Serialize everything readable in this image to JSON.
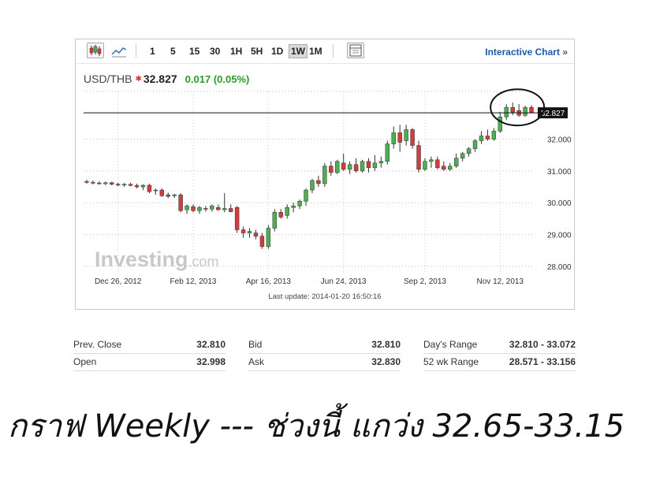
{
  "toolbar": {
    "intervals": [
      "1",
      "5",
      "15",
      "30",
      "1H",
      "5H",
      "1D",
      "1W",
      "1M"
    ],
    "active_interval": "1W",
    "interactive_label": "Interactive Chart",
    "interactive_arrow": "»",
    "icons": [
      "candlestick-chart-icon",
      "line-chart-icon",
      "settings-panel-icon"
    ]
  },
  "quote": {
    "symbol": "USD/THB",
    "price": "32.827",
    "change": "0.017 (0.05%)",
    "direction_color": "#e03030",
    "change_color": "#2a9a2a"
  },
  "chart_data": {
    "type": "candlestick",
    "ylim": [
      27.8,
      33.5
    ],
    "y_ticks": [
      "28.000",
      "29.000",
      "30.000",
      "31.000",
      "32.000"
    ],
    "x_tick_labels": [
      "Dec 26, 2012",
      "Feb 12, 2013",
      "Apr 16, 2013",
      "Jun 24, 2013",
      "Sep 2, 2013",
      "Nov 12, 2013"
    ],
    "last_price_label": "32.827",
    "last_price": 32.827,
    "up_color": "#4caf50",
    "down_color": "#d23c3c",
    "watermark": "Investing",
    "watermark_suffix": ".com",
    "candles": [
      {
        "o": 30.67,
        "h": 30.72,
        "l": 30.6,
        "c": 30.64
      },
      {
        "o": 30.64,
        "h": 30.7,
        "l": 30.58,
        "c": 30.62
      },
      {
        "o": 30.62,
        "h": 30.68,
        "l": 30.57,
        "c": 30.6
      },
      {
        "o": 30.6,
        "h": 30.66,
        "l": 30.55,
        "c": 30.63
      },
      {
        "o": 30.63,
        "h": 30.66,
        "l": 30.55,
        "c": 30.58
      },
      {
        "o": 30.58,
        "h": 30.63,
        "l": 30.52,
        "c": 30.56
      },
      {
        "o": 30.56,
        "h": 30.62,
        "l": 30.5,
        "c": 30.58
      },
      {
        "o": 30.58,
        "h": 30.63,
        "l": 30.52,
        "c": 30.54
      },
      {
        "o": 30.54,
        "h": 30.6,
        "l": 30.45,
        "c": 30.5
      },
      {
        "o": 30.5,
        "h": 30.58,
        "l": 30.4,
        "c": 30.55
      },
      {
        "o": 30.55,
        "h": 30.6,
        "l": 30.3,
        "c": 30.35
      },
      {
        "o": 30.38,
        "h": 30.45,
        "l": 30.25,
        "c": 30.4
      },
      {
        "o": 30.4,
        "h": 30.45,
        "l": 30.18,
        "c": 30.22
      },
      {
        "o": 30.25,
        "h": 30.32,
        "l": 30.15,
        "c": 30.2
      },
      {
        "o": 30.22,
        "h": 30.28,
        "l": 30.15,
        "c": 30.25
      },
      {
        "o": 30.25,
        "h": 30.3,
        "l": 29.7,
        "c": 29.75
      },
      {
        "o": 29.78,
        "h": 29.95,
        "l": 29.65,
        "c": 29.9
      },
      {
        "o": 29.88,
        "h": 29.95,
        "l": 29.7,
        "c": 29.75
      },
      {
        "o": 29.75,
        "h": 29.9,
        "l": 29.65,
        "c": 29.85
      },
      {
        "o": 29.82,
        "h": 29.9,
        "l": 29.72,
        "c": 29.8
      },
      {
        "o": 29.8,
        "h": 29.95,
        "l": 29.72,
        "c": 29.9
      },
      {
        "o": 29.85,
        "h": 29.95,
        "l": 29.75,
        "c": 29.78
      },
      {
        "o": 29.78,
        "h": 30.3,
        "l": 29.7,
        "c": 29.82
      },
      {
        "o": 29.82,
        "h": 29.95,
        "l": 29.7,
        "c": 29.72
      },
      {
        "o": 29.85,
        "h": 29.9,
        "l": 29.05,
        "c": 29.15
      },
      {
        "o": 29.15,
        "h": 29.25,
        "l": 28.9,
        "c": 29.05
      },
      {
        "o": 29.05,
        "h": 29.2,
        "l": 28.9,
        "c": 29.1
      },
      {
        "o": 29.05,
        "h": 29.15,
        "l": 28.85,
        "c": 28.95
      },
      {
        "o": 28.95,
        "h": 29.05,
        "l": 28.55,
        "c": 28.62
      },
      {
        "o": 28.62,
        "h": 29.3,
        "l": 28.55,
        "c": 29.2
      },
      {
        "o": 29.2,
        "h": 29.8,
        "l": 29.1,
        "c": 29.7
      },
      {
        "o": 29.7,
        "h": 29.8,
        "l": 29.5,
        "c": 29.55
      },
      {
        "o": 29.6,
        "h": 29.95,
        "l": 29.5,
        "c": 29.85
      },
      {
        "o": 29.85,
        "h": 30.0,
        "l": 29.7,
        "c": 29.9
      },
      {
        "o": 29.9,
        "h": 30.1,
        "l": 29.8,
        "c": 30.05
      },
      {
        "o": 30.05,
        "h": 30.45,
        "l": 29.9,
        "c": 30.4
      },
      {
        "o": 30.4,
        "h": 30.75,
        "l": 30.3,
        "c": 30.7
      },
      {
        "o": 30.7,
        "h": 30.85,
        "l": 30.5,
        "c": 30.6
      },
      {
        "o": 30.6,
        "h": 31.25,
        "l": 30.5,
        "c": 31.15
      },
      {
        "o": 31.15,
        "h": 31.3,
        "l": 30.85,
        "c": 30.95
      },
      {
        "o": 30.95,
        "h": 31.35,
        "l": 30.9,
        "c": 31.3
      },
      {
        "o": 31.25,
        "h": 31.55,
        "l": 31.0,
        "c": 31.05
      },
      {
        "o": 31.05,
        "h": 31.3,
        "l": 30.9,
        "c": 31.2
      },
      {
        "o": 31.2,
        "h": 31.4,
        "l": 30.95,
        "c": 31.0
      },
      {
        "o": 31.0,
        "h": 31.35,
        "l": 30.95,
        "c": 31.3
      },
      {
        "o": 31.3,
        "h": 31.4,
        "l": 30.95,
        "c": 31.1
      },
      {
        "o": 31.1,
        "h": 31.5,
        "l": 31.0,
        "c": 31.25
      },
      {
        "o": 31.25,
        "h": 31.45,
        "l": 31.1,
        "c": 31.3
      },
      {
        "o": 31.3,
        "h": 31.95,
        "l": 31.2,
        "c": 31.85
      },
      {
        "o": 31.85,
        "h": 32.4,
        "l": 31.7,
        "c": 32.2
      },
      {
        "o": 32.2,
        "h": 32.45,
        "l": 31.6,
        "c": 31.9
      },
      {
        "o": 31.95,
        "h": 32.45,
        "l": 31.8,
        "c": 32.3
      },
      {
        "o": 32.3,
        "h": 32.35,
        "l": 31.7,
        "c": 31.8
      },
      {
        "o": 31.8,
        "h": 31.95,
        "l": 30.95,
        "c": 31.05
      },
      {
        "o": 31.05,
        "h": 31.4,
        "l": 31.0,
        "c": 31.3
      },
      {
        "o": 31.3,
        "h": 31.45,
        "l": 31.1,
        "c": 31.35
      },
      {
        "o": 31.35,
        "h": 31.45,
        "l": 31.05,
        "c": 31.1
      },
      {
        "o": 31.15,
        "h": 31.3,
        "l": 31.0,
        "c": 31.05
      },
      {
        "o": 31.05,
        "h": 31.25,
        "l": 31.0,
        "c": 31.15
      },
      {
        "o": 31.15,
        "h": 31.55,
        "l": 31.1,
        "c": 31.4
      },
      {
        "o": 31.4,
        "h": 31.6,
        "l": 31.3,
        "c": 31.55
      },
      {
        "o": 31.55,
        "h": 31.75,
        "l": 31.45,
        "c": 31.7
      },
      {
        "o": 31.7,
        "h": 32.0,
        "l": 31.6,
        "c": 31.95
      },
      {
        "o": 31.95,
        "h": 32.25,
        "l": 31.85,
        "c": 32.1
      },
      {
        "o": 32.1,
        "h": 32.3,
        "l": 31.95,
        "c": 32.0
      },
      {
        "o": 32.0,
        "h": 32.35,
        "l": 31.95,
        "c": 32.25
      },
      {
        "o": 32.25,
        "h": 32.85,
        "l": 32.2,
        "c": 32.7
      },
      {
        "o": 32.7,
        "h": 33.1,
        "l": 32.6,
        "c": 33.0
      },
      {
        "o": 33.0,
        "h": 33.15,
        "l": 32.75,
        "c": 32.85
      },
      {
        "o": 32.9,
        "h": 33.1,
        "l": 32.7,
        "c": 32.75
      },
      {
        "o": 32.75,
        "h": 33.05,
        "l": 32.7,
        "c": 33.0
      },
      {
        "o": 33.0,
        "h": 33.07,
        "l": 32.81,
        "c": 32.827
      }
    ]
  },
  "last_update": "Last update: 2014-01-20 16:50:16",
  "stats": [
    [
      {
        "label": "Prev. Close",
        "value": "32.810"
      },
      {
        "label": "Bid",
        "value": "32.810"
      },
      {
        "label": "Day's Range",
        "value": "32.810 - 33.072"
      }
    ],
    [
      {
        "label": "Open",
        "value": "32.998"
      },
      {
        "label": "Ask",
        "value": "32.830"
      },
      {
        "label": "52 wk Range",
        "value": "28.571 - 33.156"
      }
    ]
  ],
  "caption": "กราฟ Weekly --- ช่วงนี้ แกว่ง 32.65-33.15"
}
